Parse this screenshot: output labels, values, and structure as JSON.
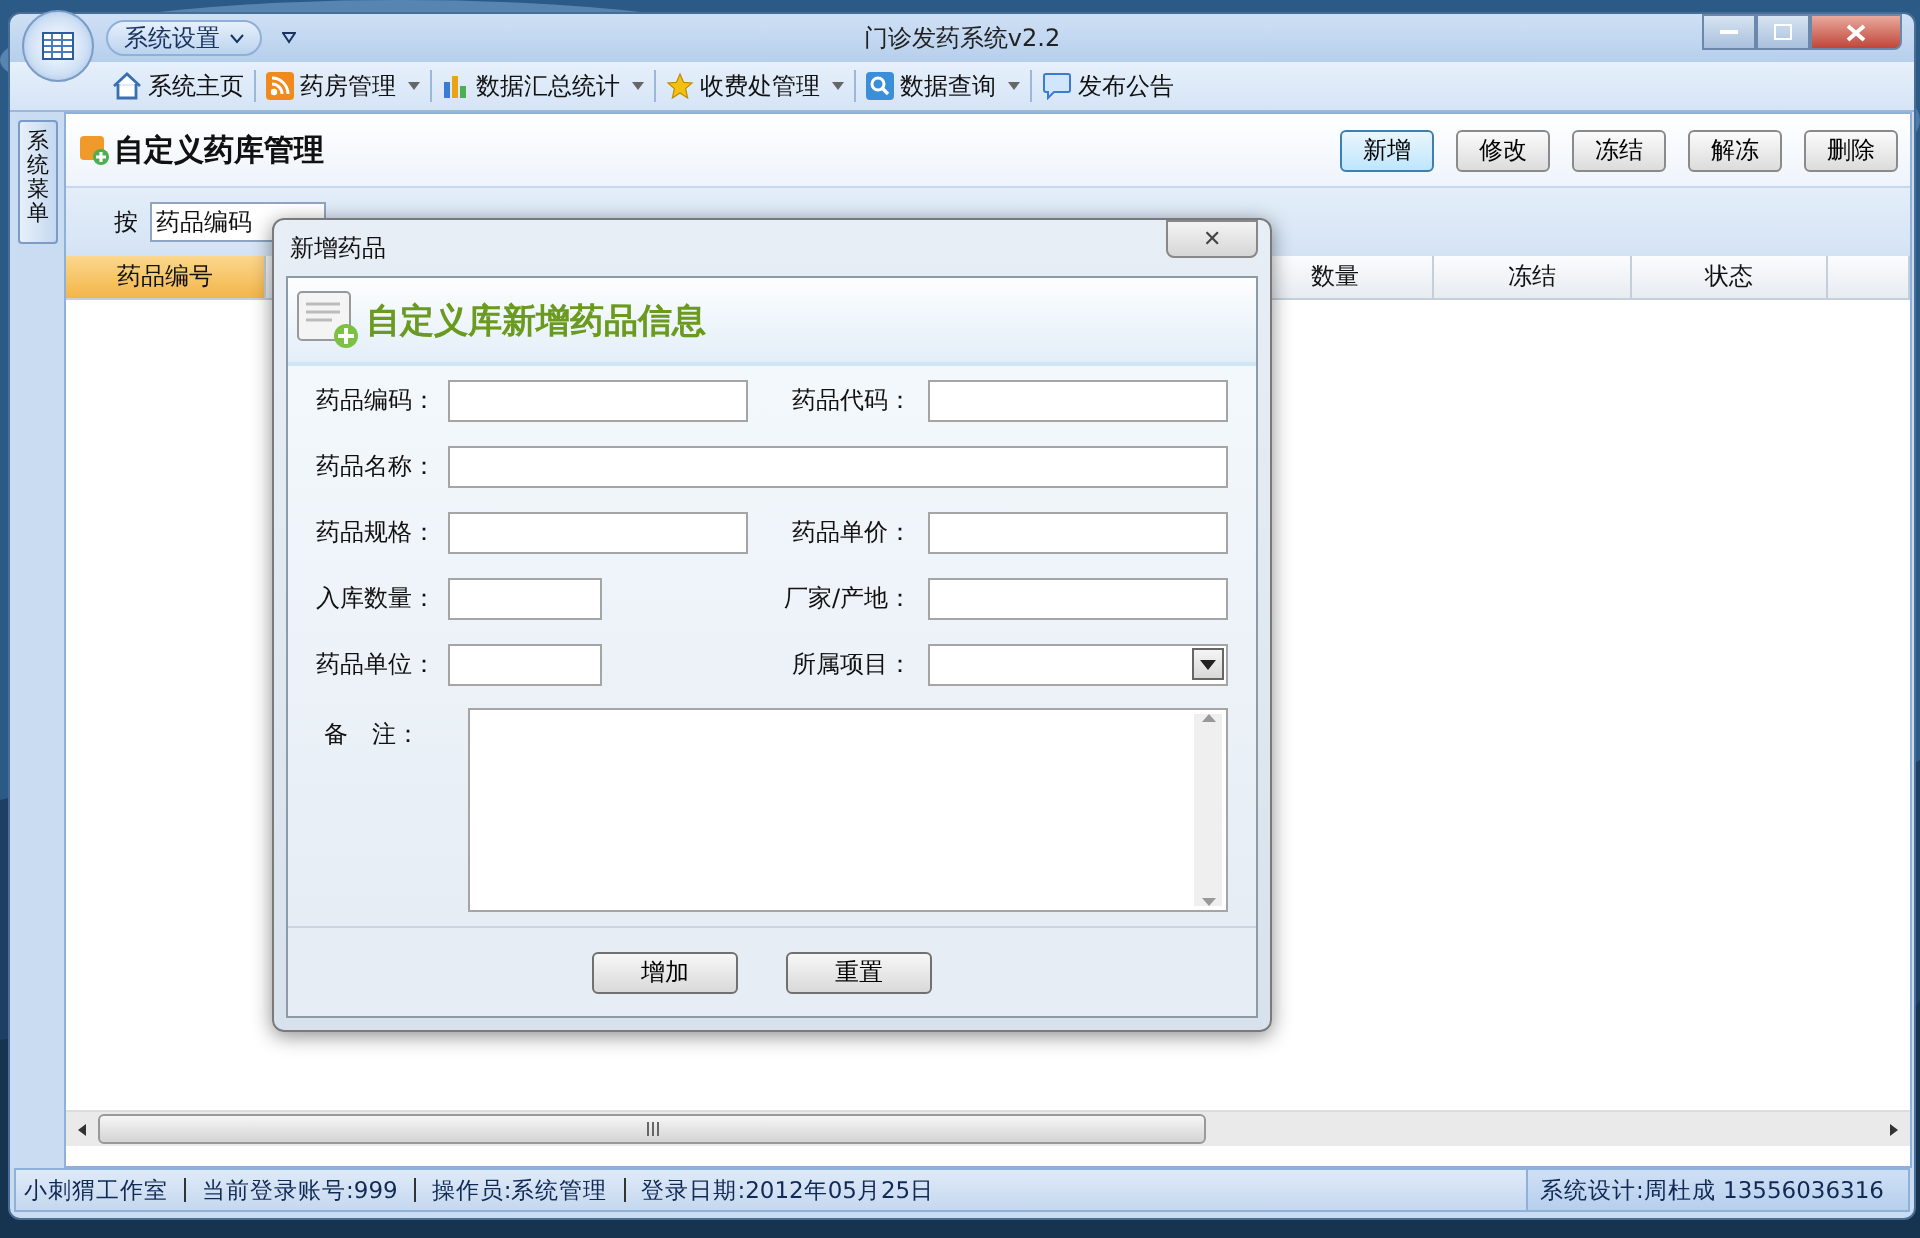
{
  "window": {
    "title": "门诊发药系统v2.2",
    "menu_button": "系统设置"
  },
  "toolbar": [
    {
      "label": "系统主页",
      "dropdown": false
    },
    {
      "label": "药房管理",
      "dropdown": true
    },
    {
      "label": "数据汇总统计",
      "dropdown": true
    },
    {
      "label": "收费处管理",
      "dropdown": true
    },
    {
      "label": "数据查询",
      "dropdown": true
    },
    {
      "label": "发布公告",
      "dropdown": false
    }
  ],
  "side_tab": "系统菜单",
  "page": {
    "title": "自定义药库管理",
    "buttons": [
      {
        "label": "新增",
        "selected": true
      },
      {
        "label": "修改",
        "selected": false
      },
      {
        "label": "冻结",
        "selected": false
      },
      {
        "label": "解冻",
        "selected": false
      },
      {
        "label": "删除",
        "selected": false
      }
    ],
    "search_label": "按",
    "search_field": "药品编码"
  },
  "table": {
    "columns": [
      {
        "label": "药品编号",
        "selected": true
      },
      {
        "selected": false
      },
      {
        "label": "数量",
        "selected": false
      },
      {
        "label": "冻结",
        "selected": false
      },
      {
        "label": "状态",
        "selected": false
      }
    ]
  },
  "dialog": {
    "title": "新增药品",
    "close": "✕",
    "heading": "自定义库新增药品信息",
    "fields": [
      {
        "label": "药品编码：",
        "kind": "text"
      },
      {
        "label": "药品代码：",
        "kind": "text"
      },
      {
        "label": "药品名称：",
        "kind": "wide"
      },
      {
        "label": "药品规格：",
        "kind": "text"
      },
      {
        "label": "药品单价：",
        "kind": "text"
      },
      {
        "label": "入库数量：",
        "kind": "short"
      },
      {
        "label": "厂家/产地：",
        "kind": "text"
      },
      {
        "label": "药品单位：",
        "kind": "short"
      },
      {
        "label": "所属项目：",
        "kind": "select"
      },
      {
        "label": "备　注：",
        "kind": "textarea"
      }
    ],
    "buttons": [
      "增加",
      "重置"
    ]
  },
  "status_bar": {
    "items": [
      "小刺猬工作室",
      "当前登录账号:999",
      "操作员:系统管理",
      "登录日期:2012年05月25日"
    ],
    "right": "系统设计:周杜成  13556036316"
  }
}
